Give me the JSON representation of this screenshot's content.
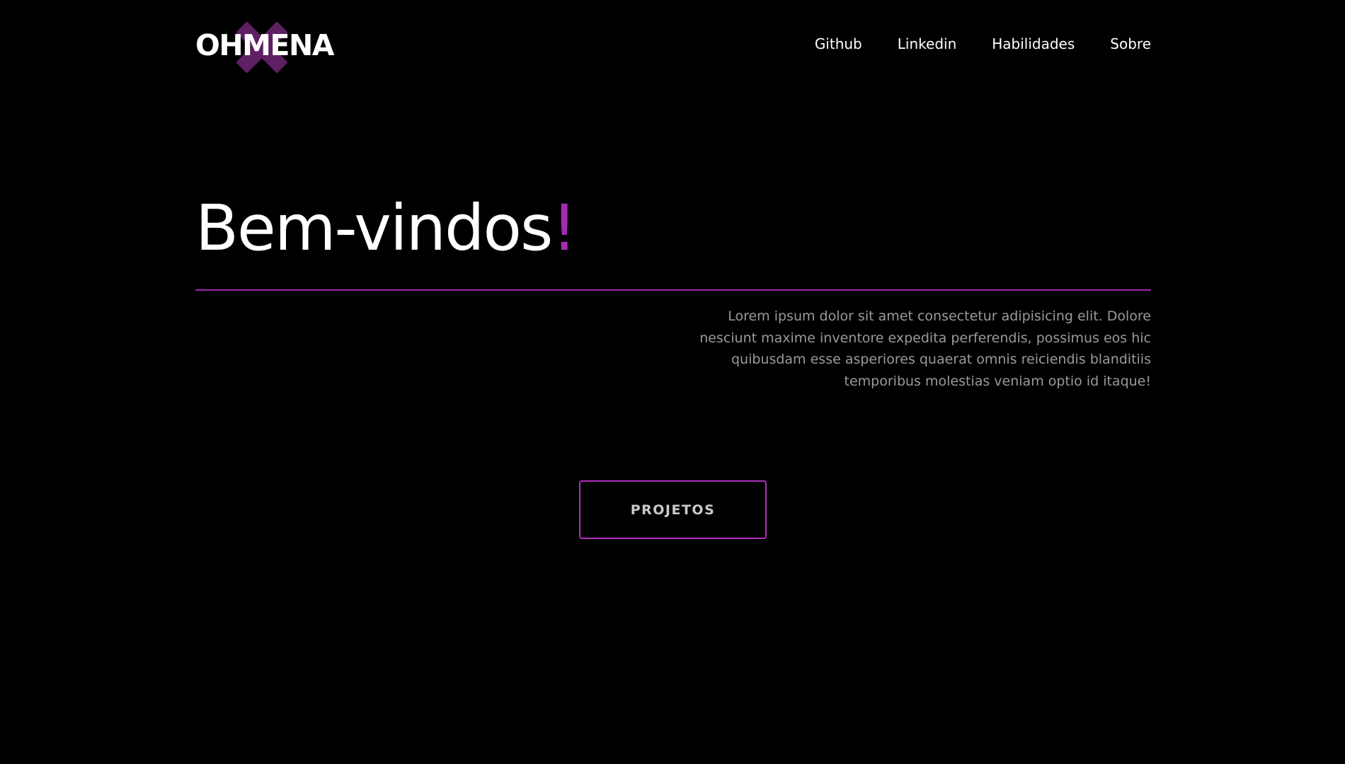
{
  "header": {
    "logo_text": "OHMENA",
    "logo_icon": "x-mark-icon",
    "nav": [
      {
        "label": "Github"
      },
      {
        "label": "Linkedin"
      },
      {
        "label": "Habilidades"
      },
      {
        "label": "Sobre"
      }
    ]
  },
  "hero": {
    "title": "Bem-vindos",
    "title_punctuation": "!",
    "intro": "Lorem ipsum dolor sit amet consectetur adipisicing elit. Dolore nesciunt maxime inventore expedita perferendis, possimus eos hic quibusdam esse asperiores quaerat omnis reiciendis blanditiis temporibus molestias veniam optio id itaque!",
    "cta_label": "PROJETOS"
  },
  "colors": {
    "background": "#000000",
    "accent": "#a52bb5",
    "logo_mark": "#5e1f63",
    "text": "#ffffff",
    "muted_text": "#9a9a9a"
  }
}
